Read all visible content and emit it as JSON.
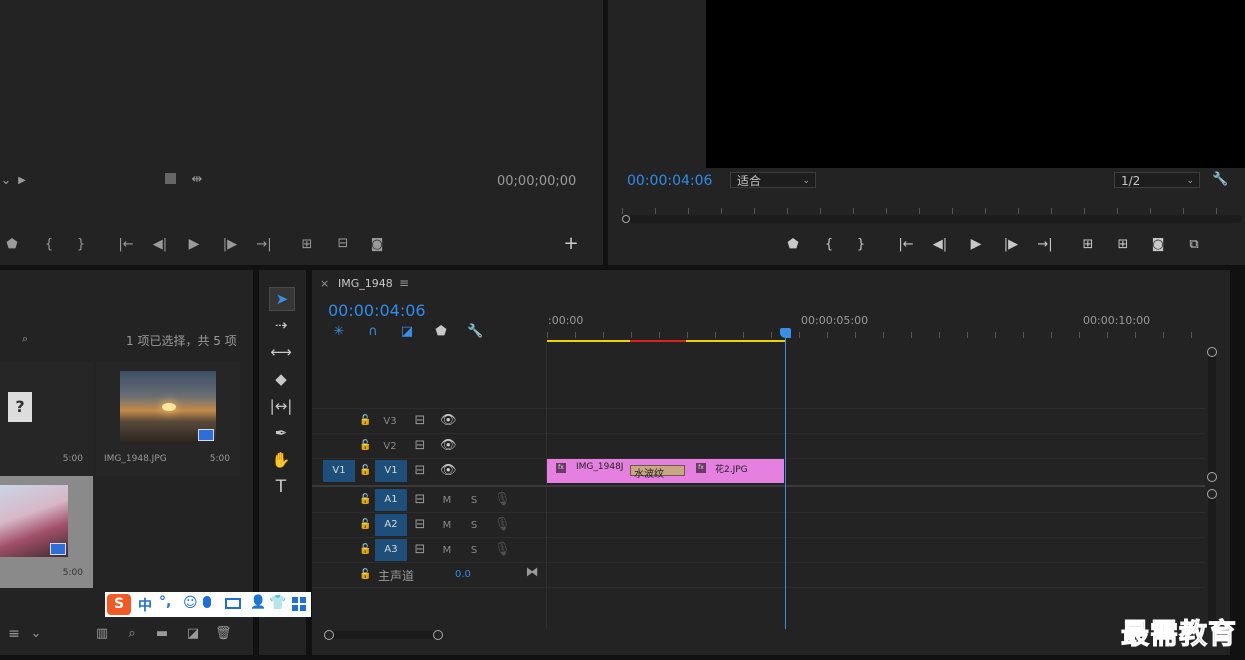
{
  "source_monitor": {
    "timecode": "00;00;00;00"
  },
  "program_monitor": {
    "timecode": "00:00:04:06",
    "fit_select": "适合",
    "resolution_select": "1/2"
  },
  "project": {
    "selection_status": "1 项已选择，共 5 项",
    "items": [
      {
        "name": "",
        "duration": "5:00"
      },
      {
        "name": "IMG_1948.JPG",
        "duration": "5:00"
      },
      {
        "name": "",
        "duration": "5:00"
      }
    ]
  },
  "timeline": {
    "tab_title": "IMG_1948",
    "close_glyph": "×",
    "menu_glyph": "≡",
    "timecode": "00:00:04:06",
    "ruler": [
      ":00:00",
      "00:00:05:00",
      "00:00:10:00"
    ],
    "video_tracks": [
      {
        "name": "V3",
        "source": ""
      },
      {
        "name": "V2",
        "source": ""
      },
      {
        "name": "V1",
        "source": "V1"
      }
    ],
    "audio_tracks": [
      {
        "name": "A1",
        "m": "M",
        "s": "S"
      },
      {
        "name": "A2",
        "m": "M",
        "s": "S"
      },
      {
        "name": "A3",
        "m": "M",
        "s": "S"
      }
    ],
    "master": {
      "label": "主声道",
      "value": "0.0"
    },
    "clips": [
      {
        "name": "IMG_1948J",
        "fx": "fx"
      },
      {
        "name": "水波纹",
        "fx": ""
      },
      {
        "name": "花2.JPG",
        "fx": "fx"
      }
    ]
  },
  "ime": {
    "lang": "中",
    "punct": "°,"
  },
  "watermark": "最需教育",
  "colors": {
    "accent": "#2d8ceb",
    "clip": "#e57fe0",
    "transition": "#c9a783",
    "playhead": "#3a8ee6"
  }
}
